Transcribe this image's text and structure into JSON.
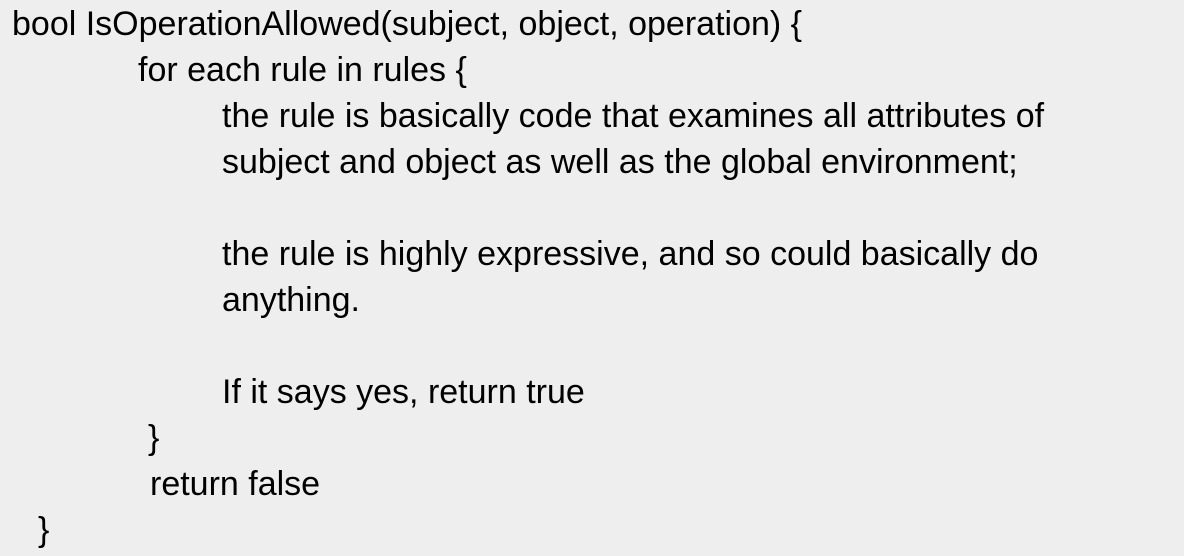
{
  "code": {
    "function_signature": "bool IsOperationAllowed(subject, object, operation) {",
    "loop_header": "for each rule in rules {",
    "rule_desc_line1": "the rule is basically code that examines all attributes of",
    "rule_desc_line2": "subject and object as well as the global environment;",
    "expressive_line1": "the rule is highly expressive, and so could basically do",
    "expressive_line2": "anything.",
    "yes_line": "If it says yes, return true",
    "loop_close": "}",
    "return_false": "return false",
    "function_close": "}"
  }
}
